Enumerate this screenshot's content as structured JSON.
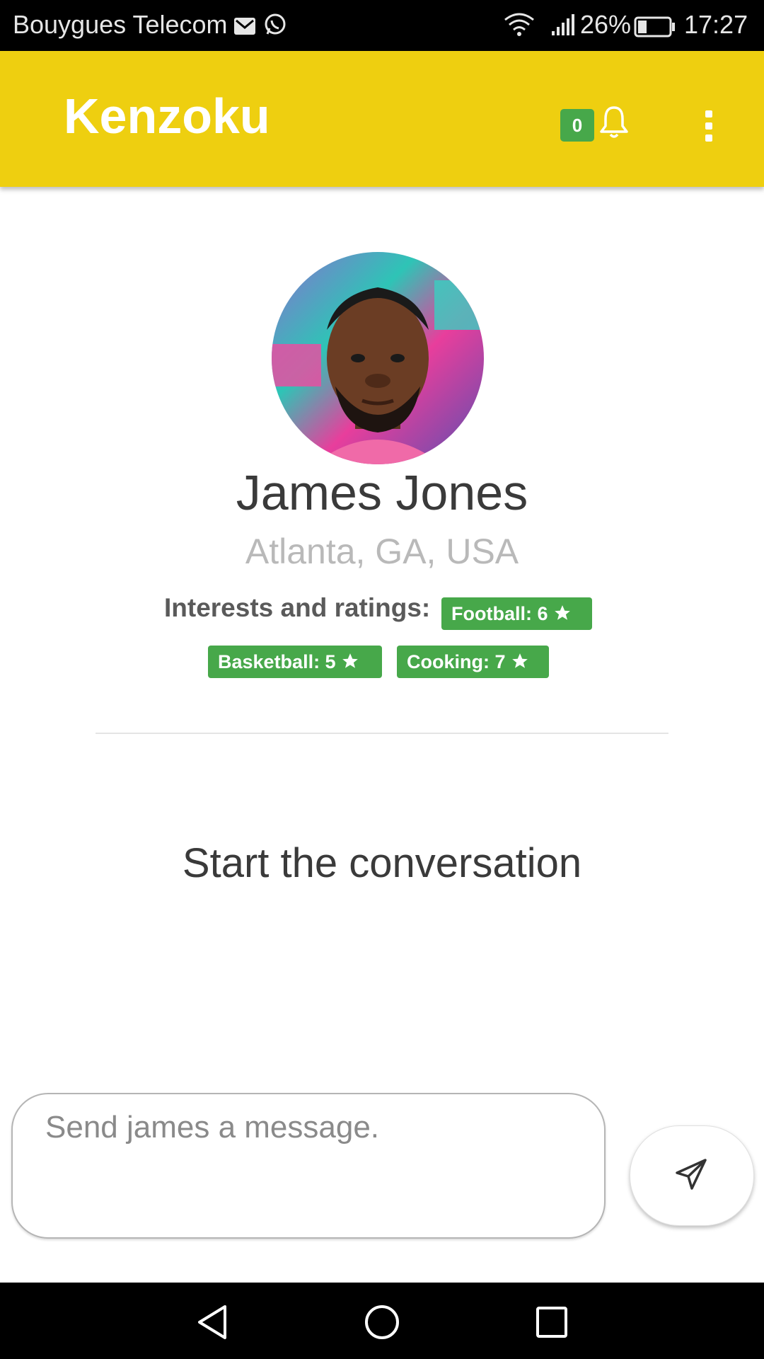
{
  "status_bar": {
    "carrier": "Bouygues Telecom",
    "battery": "26%",
    "time": "17:27",
    "icons": [
      "gmail-icon",
      "whatsapp-icon",
      "wifi-icon",
      "signal-icon",
      "battery-icon"
    ]
  },
  "app_bar": {
    "title": "Kenzoku",
    "notification_count": "0",
    "icons": [
      "bell-icon",
      "more-vert-icon"
    ],
    "color": "#eecf10"
  },
  "profile": {
    "name": "James Jones",
    "location": "Atlanta, GA, USA",
    "interests_label": "Interests and ratings:",
    "interests": [
      {
        "label": "Football: 6"
      },
      {
        "label": "Basketball: 5"
      },
      {
        "label": "Cooking: 7"
      }
    ],
    "tag_color": "#47a84a"
  },
  "conversation": {
    "empty_text": "Start the conversation"
  },
  "composer": {
    "placeholder": "Send james a message.",
    "send_icon": "send-icon"
  },
  "nav_bar": {
    "icons": [
      "back-icon",
      "home-icon",
      "recents-icon"
    ]
  }
}
